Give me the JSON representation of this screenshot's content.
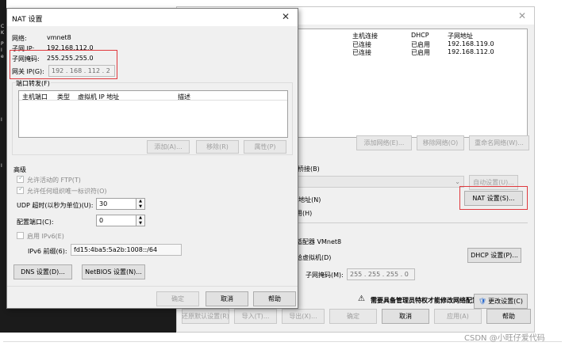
{
  "bg_window": {
    "table_headers": [
      "主机连接",
      "DHCP",
      "子网地址"
    ],
    "rows": [
      {
        "host": "已连接",
        "dhcp": "已启用",
        "subnet": "192.168.119.0"
      },
      {
        "host": "已连接",
        "dhcp": "已启用",
        "subnet": "192.168.112.0"
      }
    ],
    "btn_add_network": "添加网络(E)...",
    "btn_remove_network": "移除网络(O)",
    "btn_rename_network": "重命名网络(W)...",
    "lbl_bridged": "桥接(B)",
    "btn_auto_settings": "自动设置(U)...",
    "lbl_nat": "(地址(N)",
    "btn_nat_settings": "NAT 设置(S)...",
    "lbl_hostonly": "用(H)",
    "lbl_adapter": "适配器 VMnet8",
    "lbl_dhcp_vm": "给虚拟机(D)",
    "btn_dhcp_settings": "DHCP 设置(P)...",
    "lbl_subnet_mask": "子网掩码(M):",
    "subnet_mask_value": "255 . 255 . 255 . 0",
    "admin_warning": "需要具备管理员特权才能修改网络配置。",
    "btn_change_settings": "更改设置(C)",
    "btn_restore_defaults": "还原默认设置(R)",
    "btn_import": "导入(T)...",
    "btn_export": "导出(X)...",
    "btn_ok": "确定",
    "btn_cancel": "取消",
    "btn_apply": "应用(A)",
    "btn_help": "帮助"
  },
  "left_edge_text": [
    "C",
    "K",
    "P",
    "I",
    "e",
    "I",
    "I"
  ],
  "nat_dialog": {
    "title": "NAT 设置",
    "network_label": "网络:",
    "network_value": "vmnet8",
    "subnet_ip_label": "子网 IP:",
    "subnet_ip_value": "192.168.112.0",
    "subnet_mask_label": "子网掩码:",
    "subnet_mask_value": "255.255.255.0",
    "gateway_label": "网关 IP(G):",
    "gateway_value": "192 . 168 . 112 . 2",
    "port_forward_label": "端口转发(F)",
    "pf_headers": [
      "主机端口",
      "类型",
      "虚拟机 IP 地址",
      "描述"
    ],
    "btn_add": "添加(A)...",
    "btn_remove": "移除(R)",
    "btn_props": "属性(P)",
    "advanced_label": "高级",
    "chk_ftp": "允许活动的 FTP(T)",
    "chk_any_oui": "允许任何组织唯一标识符(O)",
    "udp_label": "UDP 超时(以秒为单位)(U):",
    "udp_value": "30",
    "config_port_label": "配置端口(C):",
    "config_port_value": "0",
    "chk_ipv6": "启用 IPv6(E)",
    "ipv6_prefix_label": "IPv6 前缀(6):",
    "ipv6_prefix_value": "fd15:4ba5:5a2b:1008::/64",
    "btn_dns": "DNS 设置(D)...",
    "btn_netbios": "NetBIOS 设置(N)...",
    "btn_ok": "确定",
    "btn_cancel": "取消",
    "btn_help": "帮助"
  },
  "watermark": "CSDN @小旺仔爱代码",
  "colors": {
    "highlight": "#e0393e",
    "dialog_bg": "#f0f0f0"
  }
}
